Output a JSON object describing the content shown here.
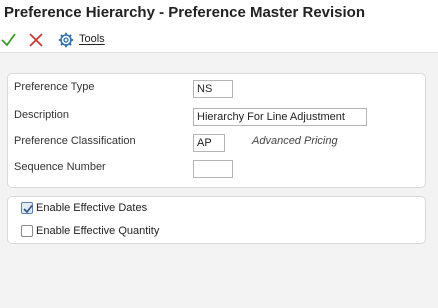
{
  "window": {
    "title": "Preference Hierarchy - Preference Master Revision"
  },
  "toolbar": {
    "ok_icon": "checkmark-icon",
    "cancel_icon": "close-icon",
    "tools_icon": "gear-icon",
    "tools_label": "Tools"
  },
  "form": {
    "preference_type": {
      "label": "Preference Type",
      "value": "NS"
    },
    "description": {
      "label": "Description",
      "value": "Hierarchy For Line Adjustment"
    },
    "preference_classification": {
      "label": "Preference Classification",
      "value": "AP",
      "description": "Advanced Pricing"
    },
    "sequence_number": {
      "label": "Sequence Number",
      "value": ""
    }
  },
  "options": {
    "enable_effective_dates": {
      "label": "Enable Effective Dates",
      "checked": true
    },
    "enable_effective_quantity": {
      "label": "Enable Effective Quantity",
      "checked": false
    }
  },
  "colors": {
    "ok_green": "#3a9a2a",
    "cancel_red": "#d0302a",
    "gear_blue": "#2f6fb5"
  }
}
